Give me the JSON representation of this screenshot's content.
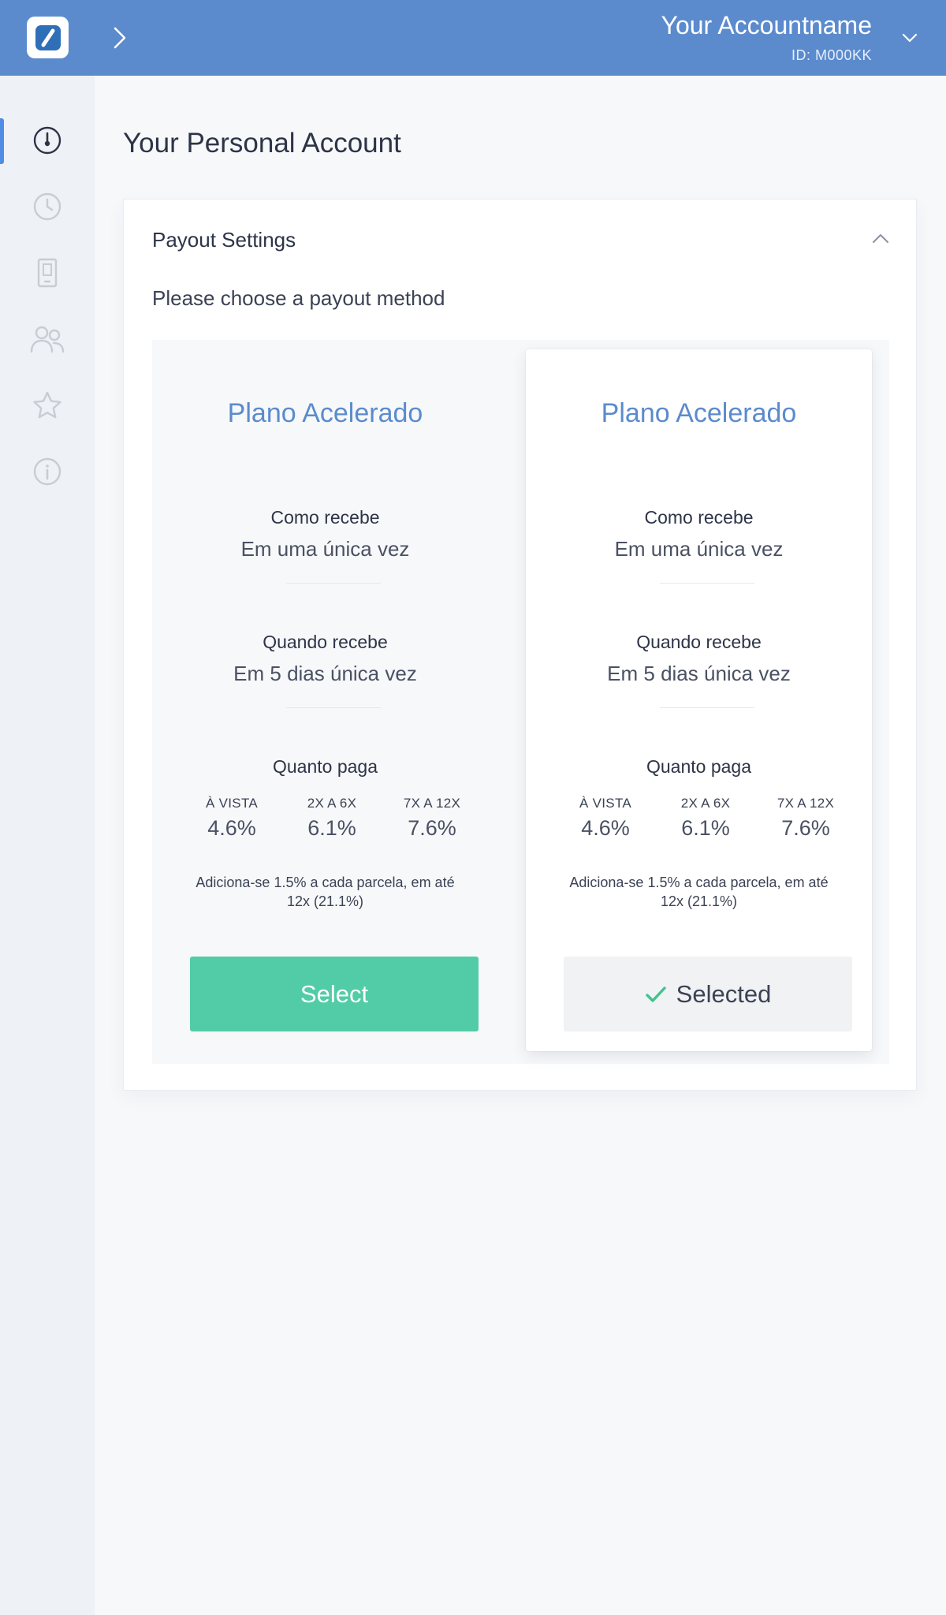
{
  "header": {
    "account_name": "Your Accountname",
    "account_id": "ID: M000KK",
    "brand_color": "#5b8bcd",
    "icons": {
      "logo": "brand-s-logo",
      "expand": "chevron-right-icon",
      "account_menu": "chevron-down-icon"
    }
  },
  "sidebar": {
    "items": [
      {
        "icon": "dashboard-gauge-icon",
        "active": true
      },
      {
        "icon": "clock-icon",
        "active": false
      },
      {
        "icon": "device-icon",
        "active": false
      },
      {
        "icon": "users-icon",
        "active": false
      },
      {
        "icon": "star-icon",
        "active": false
      },
      {
        "icon": "info-icon",
        "active": false
      }
    ],
    "active_color": "#4f8de6"
  },
  "main": {
    "page_title": "Your Personal Account",
    "panel": {
      "title": "Payout Settings",
      "subtitle": "Please choose a payout method",
      "plans": [
        {
          "name": "Plano Acelerado",
          "how_label": "Como recebe",
          "how_value": "Em uma única vez",
          "when_label": "Quando recebe",
          "when_value": "Em 5 dias única vez",
          "fees_label": "Quanto paga",
          "fees": [
            {
              "label": "À VISTA",
              "value": "4.6%"
            },
            {
              "label": "2X A 6X",
              "value": "6.1%"
            },
            {
              "label": "7X A 12X",
              "value": "7.6%"
            }
          ],
          "note_line1": "Adiciona-se 1.5% a cada parcela, em até",
          "note_line2": "12x (21.1%)",
          "button_label": "Select",
          "selected": false
        },
        {
          "name": "Plano Acelerado",
          "how_label": "Como recebe",
          "how_value": "Em uma única vez",
          "when_label": "Quando recebe",
          "when_value": "Em 5 dias única vez",
          "fees_label": "Quanto paga",
          "fees": [
            {
              "label": "À VISTA",
              "value": "4.6%"
            },
            {
              "label": "2X A 6X",
              "value": "6.1%"
            },
            {
              "label": "7X A 12X",
              "value": "7.6%"
            }
          ],
          "note_line1": "Adiciona-se 1.5% a cada parcela, em até",
          "note_line2": "12x (21.1%)",
          "button_label": "Selected",
          "selected": true
        }
      ],
      "colors": {
        "plan_name": "#5b8bcd",
        "select_button": "#52cca6",
        "check": "#3ec48f"
      }
    }
  }
}
